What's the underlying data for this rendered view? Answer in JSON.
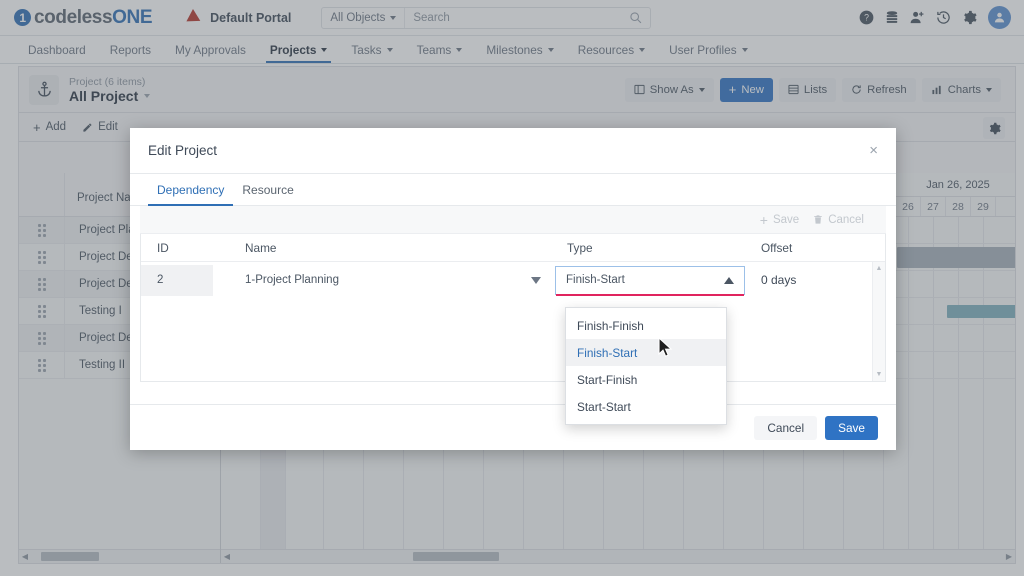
{
  "header": {
    "brand_prefix": "codeless",
    "brand_suffix": "ONE",
    "portal_label": "Default Portal",
    "object_selector": "All Objects",
    "search_placeholder": "Search",
    "search_value": "",
    "icons": [
      "help-icon",
      "database-icon",
      "add-user-icon",
      "history-icon",
      "settings-icon",
      "avatar-icon"
    ]
  },
  "nav": {
    "items": [
      {
        "label": "Dashboard",
        "has_caret": false,
        "active": false
      },
      {
        "label": "Reports",
        "has_caret": false,
        "active": false
      },
      {
        "label": "My Approvals",
        "has_caret": false,
        "active": false
      },
      {
        "label": "Projects",
        "has_caret": true,
        "active": true
      },
      {
        "label": "Tasks",
        "has_caret": true,
        "active": false
      },
      {
        "label": "Teams",
        "has_caret": true,
        "active": false
      },
      {
        "label": "Milestones",
        "has_caret": true,
        "active": false
      },
      {
        "label": "Resources",
        "has_caret": true,
        "active": false
      },
      {
        "label": "User Profiles",
        "has_caret": true,
        "active": false
      }
    ]
  },
  "list_header": {
    "subtitle": "Project (6 items)",
    "title": "All Project",
    "buttons": [
      {
        "label": "Show As",
        "icon": "layout-icon",
        "caret": true,
        "primary": false
      },
      {
        "label": "New",
        "icon": "plus-icon",
        "caret": false,
        "primary": true
      },
      {
        "label": "Lists",
        "icon": "list-icon",
        "caret": false,
        "primary": false
      },
      {
        "label": "Refresh",
        "icon": "refresh-icon",
        "caret": false,
        "primary": false
      },
      {
        "label": "Charts",
        "icon": "chart-icon",
        "caret": true,
        "primary": false
      }
    ]
  },
  "toolbar": {
    "add_label": "Add",
    "edit_label": "Edit"
  },
  "grid": {
    "column_header": "Project Name",
    "rows": [
      {
        "name": "Project Pla"
      },
      {
        "name": "Project De"
      },
      {
        "name": "Project De"
      },
      {
        "name": "Testing I"
      },
      {
        "name": "Project De"
      },
      {
        "name": "Testing II"
      }
    ]
  },
  "gantt": {
    "month_label": "Jan 26, 2025",
    "days": [
      "26",
      "27",
      "28",
      "29"
    ],
    "bars": [
      {
        "row": 1,
        "left_col": 0,
        "width_cols": 4,
        "color": "#a6b0bb"
      },
      {
        "row": 3,
        "left_col": 1,
        "width_cols": 3,
        "color": "#7fb0bd"
      }
    ]
  },
  "modal": {
    "title": "Edit Project",
    "close_label": "×",
    "tabs": [
      {
        "label": "Dependency",
        "active": true
      },
      {
        "label": "Resource",
        "active": false
      }
    ],
    "inline_actions": [
      {
        "label": "Save",
        "icon": "plus-icon"
      },
      {
        "label": "Cancel",
        "icon": "trash-icon"
      }
    ],
    "table": {
      "columns": [
        "ID",
        "Name",
        "Type",
        "Offset"
      ],
      "row": {
        "id": "2",
        "name": "1-Project Planning",
        "type": "Finish-Start",
        "offset": "0 days"
      }
    },
    "dropdown": {
      "open": true,
      "selected": "Finish-Start",
      "options": [
        "Finish-Finish",
        "Finish-Start",
        "Start-Finish",
        "Start-Start"
      ]
    },
    "footer": {
      "cancel_label": "Cancel",
      "save_label": "Save"
    }
  },
  "colors": {
    "accent_blue": "#2f73c4",
    "link_blue": "#2f6fb5",
    "underline_pink": "#e0245e",
    "gantt_bar": "#7fb0bd"
  }
}
